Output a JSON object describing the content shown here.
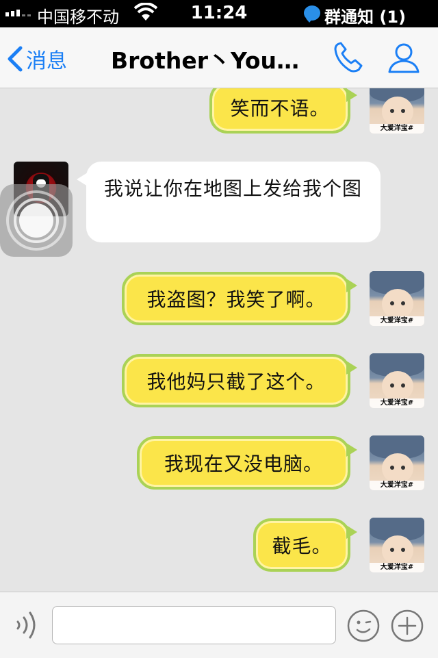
{
  "status_bar": {
    "carrier": "中国移不动",
    "time": "11:24",
    "notification": "群通知 (1)"
  },
  "nav": {
    "back_label": "消息",
    "title": "Brother丶Youn..."
  },
  "avatar_caption": "大爱洋宝#",
  "messages": [
    {
      "side": "right",
      "text": "笑而不语。"
    },
    {
      "side": "left",
      "text": "我说让你在地图上发给我个图"
    },
    {
      "side": "right",
      "text": "我盗图？我笑了啊。"
    },
    {
      "side": "right",
      "text": "我他妈只截了这个。"
    },
    {
      "side": "right",
      "text": "我现在又没电脑。"
    },
    {
      "side": "right",
      "text": "截毛。"
    }
  ],
  "input": {
    "value": "",
    "placeholder": ""
  },
  "colors": {
    "accent": "#1b7ff5",
    "bubble_right_fill": "#fbe54a",
    "bubble_right_border": "#aad256",
    "bubble_left_fill": "#ffffff",
    "chat_background": "#e5e5e5"
  },
  "icons": [
    "signal-icon",
    "wifi-icon",
    "qq-notice-icon",
    "back-chevron-icon",
    "phone-icon",
    "contact-icon",
    "voice-icon",
    "emoji-icon",
    "plus-icon"
  ]
}
